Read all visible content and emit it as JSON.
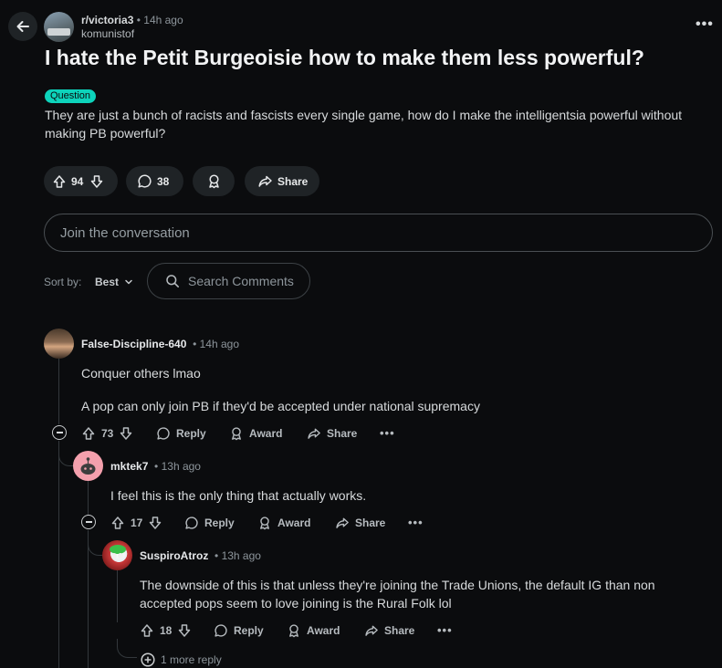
{
  "header": {
    "subreddit": "r/victoria3",
    "separator": "•",
    "time": "14h ago",
    "author": "komunistof",
    "more": "•••"
  },
  "post": {
    "title": "I hate the Petit Burgeoisie how to make them less powerful?",
    "flair": "Question",
    "body": "They are just a bunch of racists and fascists every single game, how do I make the intelligentsia powerful without making PB powerful?",
    "votes": "94",
    "comments": "38",
    "share": "Share"
  },
  "join": {
    "placeholder": "Join the conversation"
  },
  "sort": {
    "label": "Sort by:",
    "value": "Best"
  },
  "search_comments": {
    "placeholder": "Search Comments"
  },
  "comments": [
    {
      "user": "False-Discipline-640",
      "time": "14h ago",
      "lines": [
        "Conquer others lmao",
        "A pop can only join PB if they'd be accepted under national supremacy"
      ],
      "votes": "73",
      "reply": "Reply",
      "award": "Award",
      "share": "Share",
      "more": "•••"
    },
    {
      "user": "mktek7",
      "time": "13h ago",
      "lines": [
        "I feel this is the only thing that actually works."
      ],
      "votes": "17",
      "reply": "Reply",
      "award": "Award",
      "share": "Share",
      "more": "•••"
    },
    {
      "user": "SuspiroAtroz",
      "time": "13h ago",
      "lines": [
        "The downside of this is that unless they're joining the Trade Unions, the default IG than non",
        "accepted pops seem to love joining is the Rural Folk lol"
      ],
      "votes": "18",
      "reply": "Reply",
      "award": "Award",
      "share": "Share",
      "more": "•••",
      "more_replies": "1 more reply"
    }
  ],
  "colors": {
    "background": "#0b0c0e",
    "flair": "#0dd3bb",
    "pill": "#1f2326",
    "thread_line": "#33383c"
  }
}
